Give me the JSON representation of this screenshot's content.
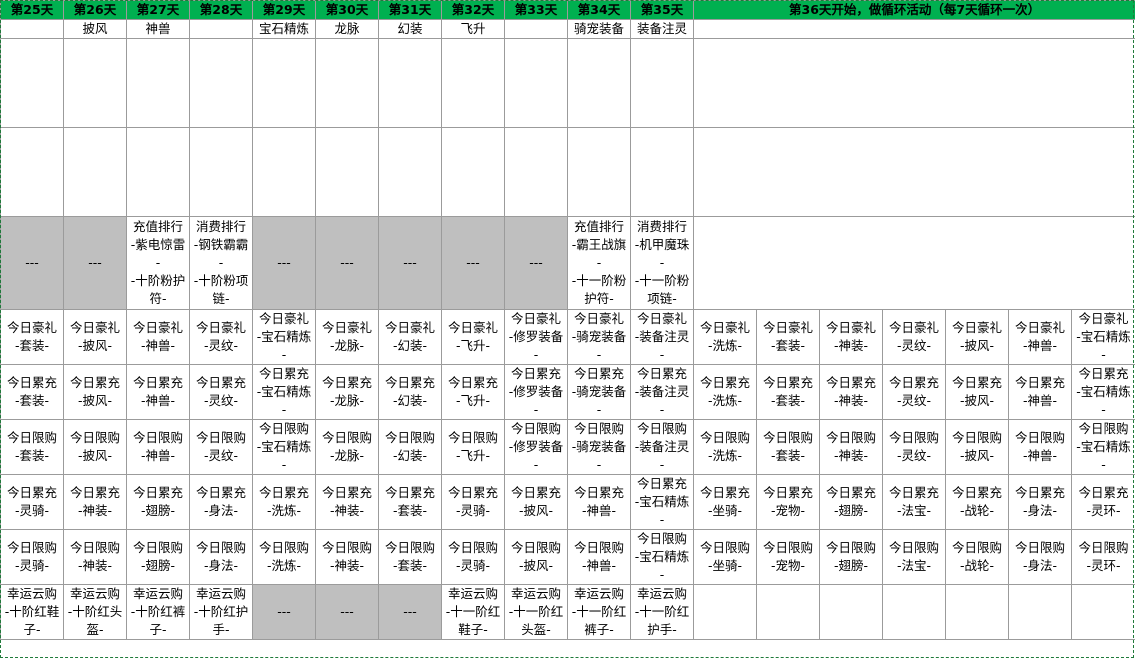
{
  "header": {
    "days": [
      "第25天",
      "第26天",
      "第27天",
      "第28天",
      "第29天",
      "第30天",
      "第31天",
      "第32天",
      "第33天",
      "第34天",
      "第35天"
    ],
    "banner": "第36天开始，做循环活动（每7天循环一次）"
  },
  "subheader": [
    "",
    "披风",
    "神兽",
    "",
    "宝石精炼",
    "龙脉",
    "幻装",
    "飞升",
    "",
    "骑宠装备",
    "装备注灵"
  ],
  "rank_row": [
    "---",
    "---",
    "充值排行\n-紫电惊雷\n-\n-十阶粉护\n符-",
    "消费排行\n-钢铁霸霸\n-\n-十阶粉项\n链-",
    "---",
    "---",
    "---",
    "---",
    "---",
    "充值排行\n-霸王战旗\n-\n-十一阶粉\n护符-",
    "消费排行\n-机甲魔珠\n-\n-十一阶粉\n项链-"
  ],
  "rows": [
    [
      "今日豪礼\n-套装-",
      "今日豪礼\n-披风-",
      "今日豪礼\n-神兽-",
      "今日豪礼\n-灵纹-",
      "今日豪礼\n-宝石精炼\n-",
      "今日豪礼\n-龙脉-",
      "今日豪礼\n-幻装-",
      "今日豪礼\n-飞升-",
      "今日豪礼\n-修罗装备\n-",
      "今日豪礼\n-骑宠装备\n-",
      "今日豪礼\n-装备注灵\n-",
      "今日豪礼\n-洗炼-",
      "今日豪礼\n-套装-",
      "今日豪礼\n-神装-",
      "今日豪礼\n-灵纹-",
      "今日豪礼\n-披风-",
      "今日豪礼\n-神兽-",
      "今日豪礼\n-宝石精炼\n-"
    ],
    [
      "今日累充\n-套装-",
      "今日累充\n-披风-",
      "今日累充\n-神兽-",
      "今日累充\n-灵纹-",
      "今日累充\n-宝石精炼\n-",
      "今日累充\n-龙脉-",
      "今日累充\n-幻装-",
      "今日累充\n-飞升-",
      "今日累充\n-修罗装备\n-",
      "今日累充\n-骑宠装备\n-",
      "今日累充\n-装备注灵\n-",
      "今日累充\n-洗炼-",
      "今日累充\n-套装-",
      "今日累充\n-神装-",
      "今日累充\n-灵纹-",
      "今日累充\n-披风-",
      "今日累充\n-神兽-",
      "今日累充\n-宝石精炼\n-"
    ],
    [
      "今日限购\n-套装-",
      "今日限购\n-披风-",
      "今日限购\n-神兽-",
      "今日限购\n-灵纹-",
      "今日限购\n-宝石精炼\n-",
      "今日限购\n-龙脉-",
      "今日限购\n-幻装-",
      "今日限购\n-飞升-",
      "今日限购\n-修罗装备\n-",
      "今日限购\n-骑宠装备\n-",
      "今日限购\n-装备注灵\n-",
      "今日限购\n-洗炼-",
      "今日限购\n-套装-",
      "今日限购\n-神装-",
      "今日限购\n-灵纹-",
      "今日限购\n-披风-",
      "今日限购\n-神兽-",
      "今日限购\n-宝石精炼\n-"
    ],
    [
      "今日累充\n-灵骑-",
      "今日累充\n-神装-",
      "今日累充\n-翅膀-",
      "今日累充\n-身法-",
      "今日累充\n-洗炼-",
      "今日累充\n-神装-",
      "今日累充\n-套装-",
      "今日累充\n-灵骑-",
      "今日累充\n-披风-",
      "今日累充\n-神兽-",
      "今日累充\n-宝石精炼\n-",
      "今日累充\n-坐骑-",
      "今日累充\n-宠物-",
      "今日累充\n-翅膀-",
      "今日累充\n-法宝-",
      "今日累充\n-战轮-",
      "今日累充\n-身法-",
      "今日累充\n-灵环-"
    ],
    [
      "今日限购\n-灵骑-",
      "今日限购\n-神装-",
      "今日限购\n-翅膀-",
      "今日限购\n-身法-",
      "今日限购\n-洗炼-",
      "今日限购\n-神装-",
      "今日限购\n-套装-",
      "今日限购\n-灵骑-",
      "今日限购\n-披风-",
      "今日限购\n-神兽-",
      "今日限购\n-宝石精炼\n-",
      "今日限购\n-坐骑-",
      "今日限购\n-宠物-",
      "今日限购\n-翅膀-",
      "今日限购\n-法宝-",
      "今日限购\n-战轮-",
      "今日限购\n-身法-",
      "今日限购\n-灵环-"
    ],
    [
      "幸运云购\n-十阶红鞋\n子-",
      "幸运云购\n-十阶红头\n盔-",
      "幸运云购\n-十阶红裤\n子-",
      "幸运云购\n-十阶红护\n手-",
      "---",
      "---",
      "---",
      "幸运云购\n-十一阶红\n鞋子-",
      "幸运云购\n-十一阶红\n头盔-",
      "幸运云购\n-十一阶红\n裤子-",
      "幸运云购\n-十一阶红\n护手-",
      "",
      "",
      "",
      "",
      "",
      "",
      ""
    ]
  ],
  "gray_markers": "---",
  "colors": {
    "header_bg": "#00b050",
    "gray_bg": "#bfbfbf",
    "grid": "#9b9b9b"
  }
}
